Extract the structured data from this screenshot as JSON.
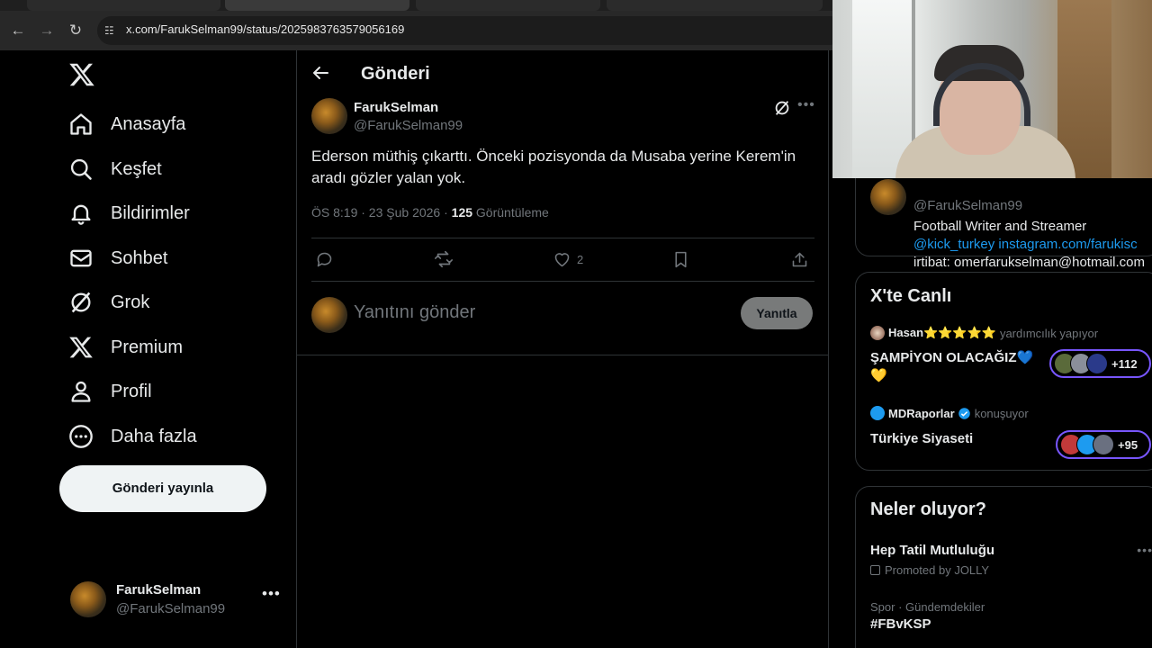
{
  "browser": {
    "url": "x.com/FarukSelman99/status/2025983763579056169"
  },
  "sidebar": {
    "items": [
      {
        "label": "Anasayfa",
        "icon": "home-icon"
      },
      {
        "label": "Keşfet",
        "icon": "search-icon"
      },
      {
        "label": "Bildirimler",
        "icon": "bell-icon"
      },
      {
        "label": "Sohbet",
        "icon": "mail-icon"
      },
      {
        "label": "Grok",
        "icon": "grok-icon"
      },
      {
        "label": "Premium",
        "icon": "x-logo-icon"
      },
      {
        "label": "Profil",
        "icon": "person-icon"
      },
      {
        "label": "Daha fazla",
        "icon": "more-circle-icon"
      }
    ],
    "post_button": "Gönderi yayınla",
    "account": {
      "name": "FarukSelman",
      "handle": "@FarukSelman99"
    }
  },
  "main": {
    "title": "Gönderi",
    "post": {
      "name": "FarukSelman",
      "handle": "@FarukSelman99",
      "text": "Ederson müthiş çıkarttı. Önceki pozisyonda da Musaba yerine Kerem'in aradı gözler yalan yok.",
      "time": "ÖS 8:19 · 23 Şub 2026 · ",
      "views": "125",
      "views_label": " Görüntüleme",
      "likes": "2"
    },
    "reply": {
      "placeholder": "Yanıtını gönder",
      "button": "Yanıtla"
    }
  },
  "right": {
    "profile": {
      "handle": "@FarukSelman99",
      "bio": "Football Writer and Streamer",
      "links": "@kick_turkey instagram.com/farukisc",
      "contact": "irtibat: omerfarukselman@hotmail.com"
    },
    "live": {
      "title": "X'te Canlı",
      "items": [
        {
          "user": "Hasan⭐⭐⭐⭐⭐",
          "status": "yardımcılık yapıyor",
          "title": "ŞAMPİYON OLACAĞIZ💙",
          "title2": "💛",
          "count": "+112"
        },
        {
          "user": "MDRaporlar",
          "status": "konuşuyor",
          "title": "Türkiye Siyaseti",
          "count": "+95"
        }
      ]
    },
    "trends": {
      "title": "Neler oluyor?",
      "items": [
        {
          "title": "Hep Tatil Mutluluğu",
          "meta": "Promoted by JOLLY"
        },
        {
          "meta": "Spor · Gündemdekiler",
          "title": "#FBvKSP"
        }
      ]
    }
  },
  "colors": {
    "accent": "#1d9bf0",
    "background": "#000000",
    "muted": "#71767b",
    "live_ring": "#7856ff"
  }
}
